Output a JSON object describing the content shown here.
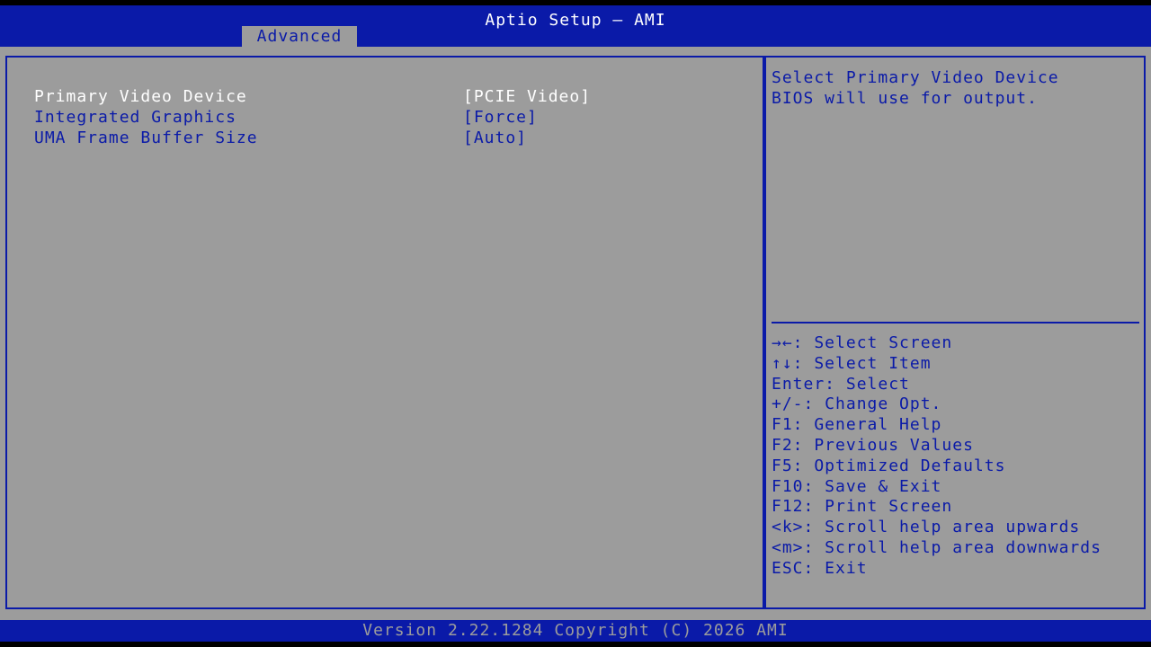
{
  "header": {
    "title": "Aptio Setup – AMI",
    "tab_label": "Advanced"
  },
  "options": [
    {
      "label": "Primary Video Device",
      "value": "[PCIE Video]"
    },
    {
      "label": "Integrated Graphics",
      "value": "[Force]"
    },
    {
      "label": "UMA Frame Buffer Size",
      "value": "[Auto]"
    }
  ],
  "help": {
    "lines": [
      "Select Primary Video Device",
      "BIOS will use for output."
    ]
  },
  "keys": [
    "→←: Select Screen",
    "↑↓: Select Item",
    "Enter: Select",
    "+/-: Change Opt.",
    "F1: General Help",
    "F2: Previous Values",
    "F5: Optimized Defaults",
    "F10: Save & Exit",
    "F12: Print Screen",
    "<k>: Scroll help area upwards",
    "<m>: Scroll help area downwards",
    "ESC: Exit"
  ],
  "footer": {
    "text": "Version 2.22.1284 Copyright (C) 2026 AMI"
  },
  "colors": {
    "background": "#9c9c9c",
    "accent_blue": "#0a1aa8",
    "selected_text": "#ffffff"
  }
}
